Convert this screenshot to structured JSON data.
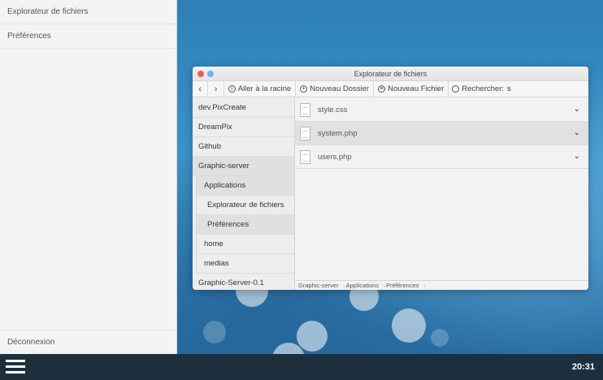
{
  "side_menu": {
    "items": [
      {
        "label": "Explorateur de fichiers"
      },
      {
        "label": "Préférences"
      }
    ],
    "logout_label": "Déconnexion"
  },
  "window": {
    "title": "Explorateur de fichiers",
    "toolbar": {
      "back": "‹",
      "forward": "›",
      "root_label": "Aller à la racine",
      "new_folder_label": "Nouveau Dossier",
      "new_file_label": "Nouveau Fichier",
      "search_label": "Rechercher:",
      "search_value": "s"
    },
    "folders": [
      {
        "label": "dev.PixCreate"
      },
      {
        "label": "DreamPix"
      },
      {
        "label": "Github"
      },
      {
        "label": "Graphic-server"
      },
      {
        "label": "Applications"
      },
      {
        "label": "Explorateur de fichiers"
      },
      {
        "label": "Préférences"
      },
      {
        "label": "home"
      },
      {
        "label": "medias"
      },
      {
        "label": "Graphic-Server-0.1"
      }
    ],
    "files": [
      {
        "name": "style.css"
      },
      {
        "name": "system.php"
      },
      {
        "name": "users.php"
      }
    ],
    "breadcrumb": [
      "Graphic-server",
      "Applications",
      "Préférences"
    ]
  },
  "taskbar": {
    "clock": "20:31"
  },
  "icons": {
    "root": "info-circle-icon",
    "new_folder": "plus-circle-icon",
    "new_file": "file-circle-icon",
    "search": "search-icon",
    "file": "file-icon",
    "expand": "chevron-down-icon",
    "menu": "hamburger-icon"
  },
  "colors": {
    "close": "#ee5b55",
    "minimize": "#66b6f1",
    "taskbar": "#1d2f3d"
  }
}
